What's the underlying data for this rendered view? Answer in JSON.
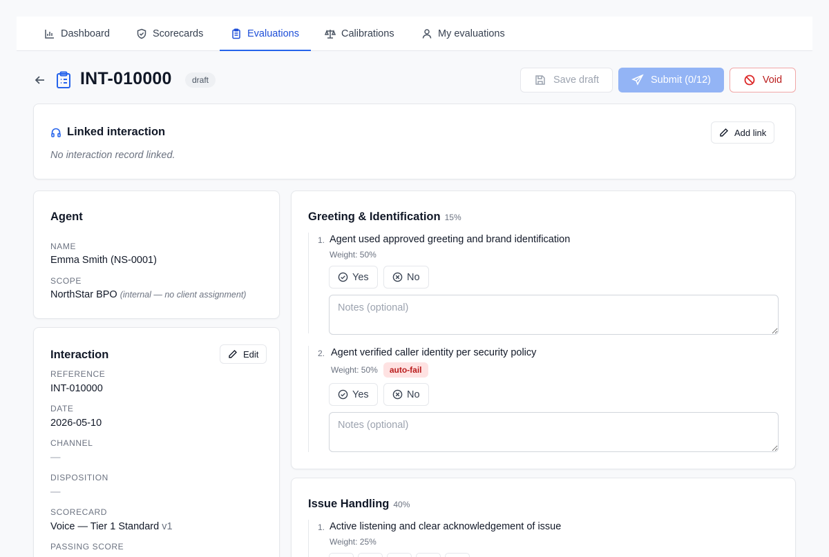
{
  "nav": {
    "tabs": [
      {
        "label": "Dashboard",
        "icon": "bar-chart-icon"
      },
      {
        "label": "Scorecards",
        "icon": "shield-check-icon"
      },
      {
        "label": "Evaluations",
        "icon": "clipboard-list-icon",
        "active": true
      },
      {
        "label": "Calibrations",
        "icon": "scale-icon"
      },
      {
        "label": "My evaluations",
        "icon": "user-icon"
      }
    ]
  },
  "header": {
    "title": "INT-010000",
    "status": "draft",
    "save_label": "Save draft",
    "submit_label": "Submit (0/12)",
    "void_label": "Void"
  },
  "linked": {
    "title": "Linked interaction",
    "empty_text": "No interaction record linked.",
    "add_label": "Add link"
  },
  "agent": {
    "title": "Agent",
    "name_label": "NAME",
    "name": "Emma Smith (NS-0001)",
    "scope_label": "SCOPE",
    "scope": "NorthStar BPO",
    "scope_note": "(internal — no client assignment)"
  },
  "interaction": {
    "title": "Interaction",
    "edit_label": "Edit",
    "reference_label": "REFERENCE",
    "reference": "INT-010000",
    "date_label": "DATE",
    "date": "2026-05-10",
    "channel_label": "CHANNEL",
    "channel": "—",
    "disposition_label": "DISPOSITION",
    "disposition": "—",
    "scorecard_label": "SCORECARD",
    "scorecard": "Voice — Tier 1 Standard",
    "scorecard_version": "v1",
    "passing_label": "PASSING SCORE"
  },
  "sections": [
    {
      "title": "Greeting & Identification",
      "pct": "15%",
      "questions": [
        {
          "num": "1.",
          "text": "Agent used approved greeting and brand identification",
          "weight": "Weight: 50%",
          "flag": ""
        },
        {
          "num": "2.",
          "text": "Agent verified caller identity per security policy",
          "weight": "Weight: 50%",
          "flag": "auto-fail"
        }
      ]
    },
    {
      "title": "Issue Handling",
      "pct": "40%",
      "questions": [
        {
          "num": "1.",
          "text": "Active listening and clear acknowledgement of issue",
          "weight": "Weight: 25%"
        }
      ]
    }
  ],
  "answers": {
    "yes": "Yes",
    "no": "No",
    "notes_placeholder": "Notes (optional)"
  },
  "colors": {
    "accent": "#2563eb",
    "danger": "#b91c1c",
    "submit_disabled": "#93b4f5"
  }
}
